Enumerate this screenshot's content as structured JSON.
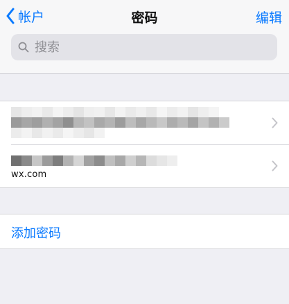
{
  "nav": {
    "back_label": "帐户",
    "title": "密码",
    "edit_label": "编辑"
  },
  "search": {
    "placeholder": "搜索",
    "value": ""
  },
  "passwords": [
    {
      "redacted": true,
      "site": ""
    },
    {
      "redacted": true,
      "site": "wx.com"
    }
  ],
  "add_password_label": "添加密码",
  "colors": {
    "accent": "#0a7aff",
    "background": "#efeff4"
  }
}
